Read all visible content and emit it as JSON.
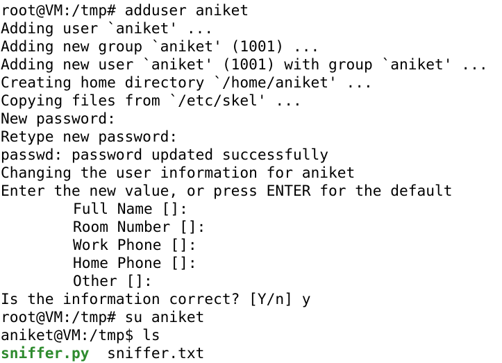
{
  "terminal": {
    "lines": [
      "root@VM:/tmp# adduser aniket",
      "Adding user `aniket' ...",
      "Adding new group `aniket' (1001) ...",
      "Adding new user `aniket' (1001) with group `aniket' ...",
      "Creating home directory `/home/aniket' ...",
      "Copying files from `/etc/skel' ...",
      "New password:",
      "Retype new password:",
      "passwd: password updated successfully",
      "Changing the user information for aniket",
      "Enter the new value, or press ENTER for the default",
      "Full Name []:",
      "Room Number []:",
      "Work Phone []:",
      "Home Phone []:",
      "Other []:",
      "Is the information correct? [Y/n] y",
      "root@VM:/tmp# su aniket",
      "aniket@VM:/tmp$ ls"
    ],
    "ls_output": {
      "file1": "sniffer.py",
      "file2": "sniffer.txt",
      "executable_color": "#2e8b2e"
    }
  }
}
